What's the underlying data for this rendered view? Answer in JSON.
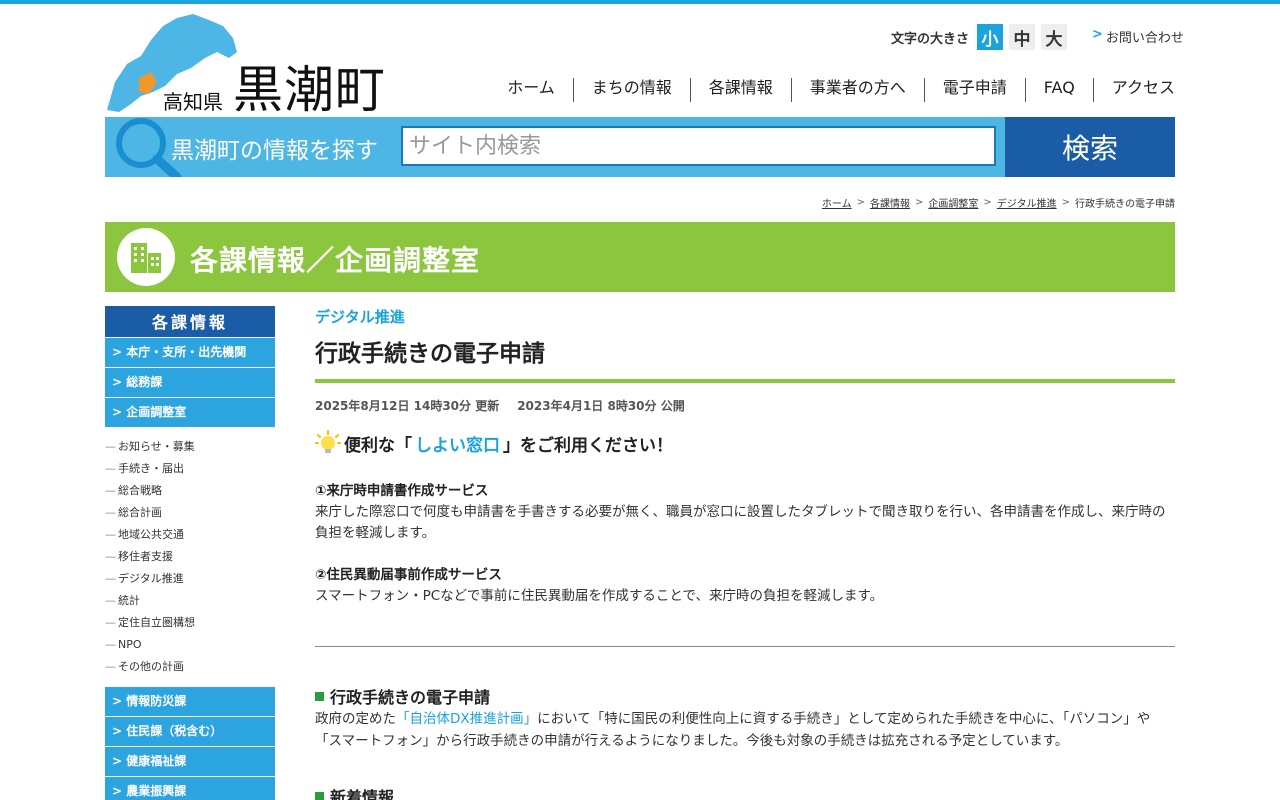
{
  "header": {
    "prefecture": "高知県",
    "town": "黒潮町",
    "font_size_label": "文字の大きさ",
    "font_sizes": [
      "小",
      "中",
      "大"
    ],
    "font_size_selected": "小",
    "contact_arrow": ">",
    "contact": "お問い合わせ"
  },
  "nav": [
    "ホーム",
    "まちの情報",
    "各課情報",
    "事業者の方へ",
    "電子申請",
    "FAQ",
    "アクセス"
  ],
  "search": {
    "label": "黒潮町の情報を探す",
    "placeholder": "サイト内検索",
    "button": "検索"
  },
  "breadcrumb": {
    "items": [
      "ホーム",
      "各課情報",
      "企画調整室",
      "デジタル推進"
    ],
    "current": "行政手続きの電子申請",
    "sep": ">"
  },
  "dept_banner": {
    "title": "各課情報／企画調整室"
  },
  "sidebar": {
    "heading": "各課情報",
    "top_items": [
      "> 本庁・支所・出先機関",
      "> 総務課",
      "> 企画調整室"
    ],
    "sub_items": [
      "お知らせ・募集",
      "手続き・届出",
      "総合戦略",
      "総合計画",
      "地域公共交通",
      "移住者支援",
      "デジタル推進",
      "統計",
      "定住自立圏構想",
      "NPO",
      "その他の計画"
    ],
    "sub_dash": "—",
    "bottom_items": [
      "> 情報防災課",
      "> 住民課（税含む）",
      "> 健康福祉課",
      "> 農業振興課"
    ]
  },
  "main": {
    "category": "デジタル推進",
    "title": "行政手続きの電子申請",
    "updated": "2025年8月12日 14時30分 更新",
    "published": "2023年4月1日 8時30分 公開",
    "notice_pre": "便利な「",
    "notice_link": "しよい窓口",
    "notice_post": "」をご利用ください！",
    "service1_title": "①来庁時申請書作成サービス",
    "service1_body": "来庁した際窓口で何度も申請書を手書きする必要が無く、職員が窓口に設置したタブレットで聞き取りを行い、各申請書を作成し、来庁時の負担を軽減します。",
    "service2_title": "②住民異動届事前作成サービス",
    "service2_body": "スマートフォン・PCなどで事前に住民異動届を作成することで、来庁時の負担を軽減します。",
    "h3_1": "行政手続きの電子申請",
    "para_pre": "政府の定めた",
    "para_link": "「自治体DX推進計画」",
    "para_post": "において「特に国民の利便性向上に資する手続き」として定められた手続きを中心に、「パソコン」や「スマートフォン」から行政手続きの申請が行えるようになりました。今後も対象の手続きは拡充される予定としています。",
    "h3_2": "新着情報"
  },
  "colors": {
    "accent": "#1aa3dd",
    "search_bg": "#4db6e5",
    "search_button": "#1a5da6",
    "banner_green": "#8cc63f",
    "sidebar_item": "#2ba4e0",
    "sidebar_head": "#1a5da6"
  }
}
